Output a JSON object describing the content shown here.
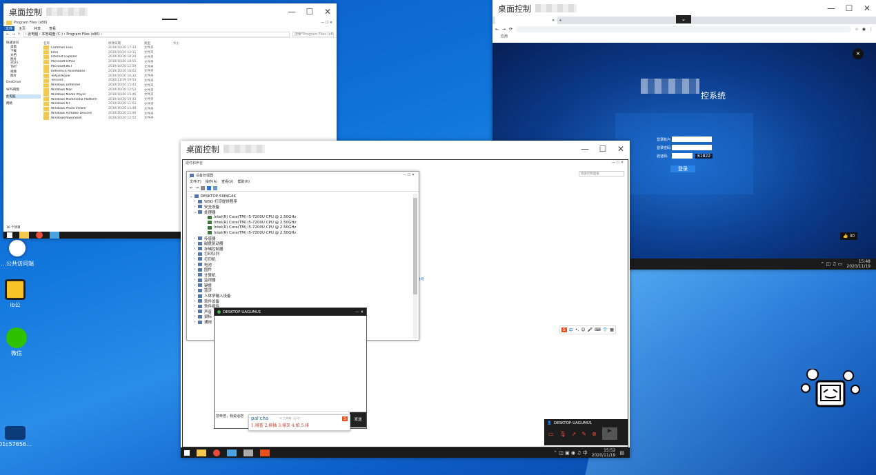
{
  "window_title": "桌面控制",
  "explorer": {
    "title": "Program Files (x86)",
    "ribbon": [
      "文件",
      "主页",
      "共享",
      "查看"
    ],
    "path": "› 此电脑 › 本地磁盘 (C:) › Program Files (x86) ›",
    "search_placeholder": "搜索\"Program Files (x86)\"",
    "columns": [
      "名称",
      "修改日期",
      "类型",
      "大小"
    ],
    "nav": [
      "快速访问",
      "桌面",
      "下载",
      "文档",
      "图片",
      "2021",
      "TMT",
      "视频",
      "图片",
      "OneDrive",
      "WPS网盘",
      "此电脑",
      "网络"
    ],
    "files": [
      {
        "name": "Common Files",
        "date": "2019/10/20 17:33",
        "type": "文件夹"
      },
      {
        "name": "Intel",
        "date": "2019/10/20 12:31",
        "type": "文件夹"
      },
      {
        "name": "Internet Explorer",
        "date": "2019/10/20 18:24",
        "type": "文件夹"
      },
      {
        "name": "Microsoft Office",
        "date": "2019/10/20 18:55",
        "type": "文件夹"
      },
      {
        "name": "Microsoft.NET",
        "date": "2019/10/20 12:59",
        "type": "文件夹"
      },
      {
        "name": "Reference Assemblies",
        "date": "2019/10/20 18:02",
        "type": "文件夹"
      },
      {
        "name": "TeXperKeyer",
        "date": "2019/10/20 16:32",
        "type": "文件夹"
      },
      {
        "name": "Tencent",
        "date": "2020/11/19 19:53",
        "type": "文件夹"
      },
      {
        "name": "Windows Defender",
        "date": "2019/10/20 15:43",
        "type": "文件夹"
      },
      {
        "name": "Windows Mail",
        "date": "2019/10/20 12:52",
        "type": "文件夹"
      },
      {
        "name": "Windows Media Player",
        "date": "2019/10/20 15:46",
        "type": "文件夹"
      },
      {
        "name": "Windows Multimedia Platform",
        "date": "2019/10/20 19:43",
        "type": "文件夹"
      },
      {
        "name": "Windows NT",
        "date": "2019/10/20 11:02",
        "type": "文件夹"
      },
      {
        "name": "Windows Photo Viewer",
        "date": "2019/10/20 15:46",
        "type": "文件夹"
      },
      {
        "name": "Windows Portable Devices",
        "date": "2019/10/20 15:46",
        "type": "文件夹"
      },
      {
        "name": "WindowsPowerShell",
        "date": "2019/10/20 12:52",
        "type": "文件夹"
      }
    ],
    "status": "16 个项目"
  },
  "browser": {
    "bookmarks": "应用",
    "login_title": "控系统",
    "username_label": "登录账户:",
    "password_label": "登录密码:",
    "captcha_label": "验证码:",
    "captcha_value": "61822",
    "login_button": "登录",
    "counter": "30",
    "time": "15:48",
    "date": "2020/11/19"
  },
  "center": {
    "control_panel_title": "硬件和声音",
    "cp_search": "搜索控制面板",
    "devmgr_title": "设备管理器",
    "menu": [
      "文件(F)",
      "操作(A)",
      "查看(V)",
      "帮助(H)"
    ],
    "root": "DESKTOP-5I9NG4K",
    "tree": [
      {
        "label": "WSD 打印提供程序",
        "level": 1
      },
      {
        "label": "安全设备",
        "level": 1
      },
      {
        "label": "处理器",
        "level": 1
      },
      {
        "label": "Intel(R) Core(TM) i5-7200U CPU @ 2.50GHz",
        "level": 2
      },
      {
        "label": "Intel(R) Core(TM) i5-7200U CPU @ 2.50GHz",
        "level": 2
      },
      {
        "label": "Intel(R) Core(TM) i5-7200U CPU @ 2.50GHz",
        "level": 2
      },
      {
        "label": "Intel(R) Core(TM) i5-7200U CPU @ 2.50GHz",
        "level": 2
      },
      {
        "label": "传感器",
        "level": 1
      },
      {
        "label": "磁盘驱动器",
        "level": 1
      },
      {
        "label": "存储控制器",
        "level": 1
      },
      {
        "label": "打印队列",
        "level": 1
      },
      {
        "label": "打印机",
        "level": 1
      },
      {
        "label": "电池",
        "level": 1
      },
      {
        "label": "固件",
        "level": 1
      },
      {
        "label": "计算机",
        "level": 1
      },
      {
        "label": "监视器",
        "level": 1
      },
      {
        "label": "键盘",
        "level": 1
      },
      {
        "label": "蓝牙",
        "level": 1
      },
      {
        "label": "人体学输入设备",
        "level": 1
      },
      {
        "label": "软件设备",
        "level": 1
      },
      {
        "label": "软件组件",
        "level": 1
      },
      {
        "label": "声音",
        "level": 1
      },
      {
        "label": "鼠标",
        "level": 1
      },
      {
        "label": "通用",
        "level": 1
      }
    ],
    "link": "录号",
    "chat_title": "DESKTOP-UAGUMU1",
    "chat_input": "您辛苦，我说话您",
    "send_button": "发送",
    "ime_pinyin": "pai'cha",
    "ime_hint": "① 工具箱（分号）",
    "ime_candidates": "1.排查  2.排插  3.排叉  4.拍  5.排",
    "mini_title": "DESKTOP-UAGUMU1",
    "time": "15:52",
    "date": "2020/11/19"
  },
  "desktop_icons": [
    "…公共访问端",
    "ib公",
    "微信",
    "01c57656…"
  ]
}
